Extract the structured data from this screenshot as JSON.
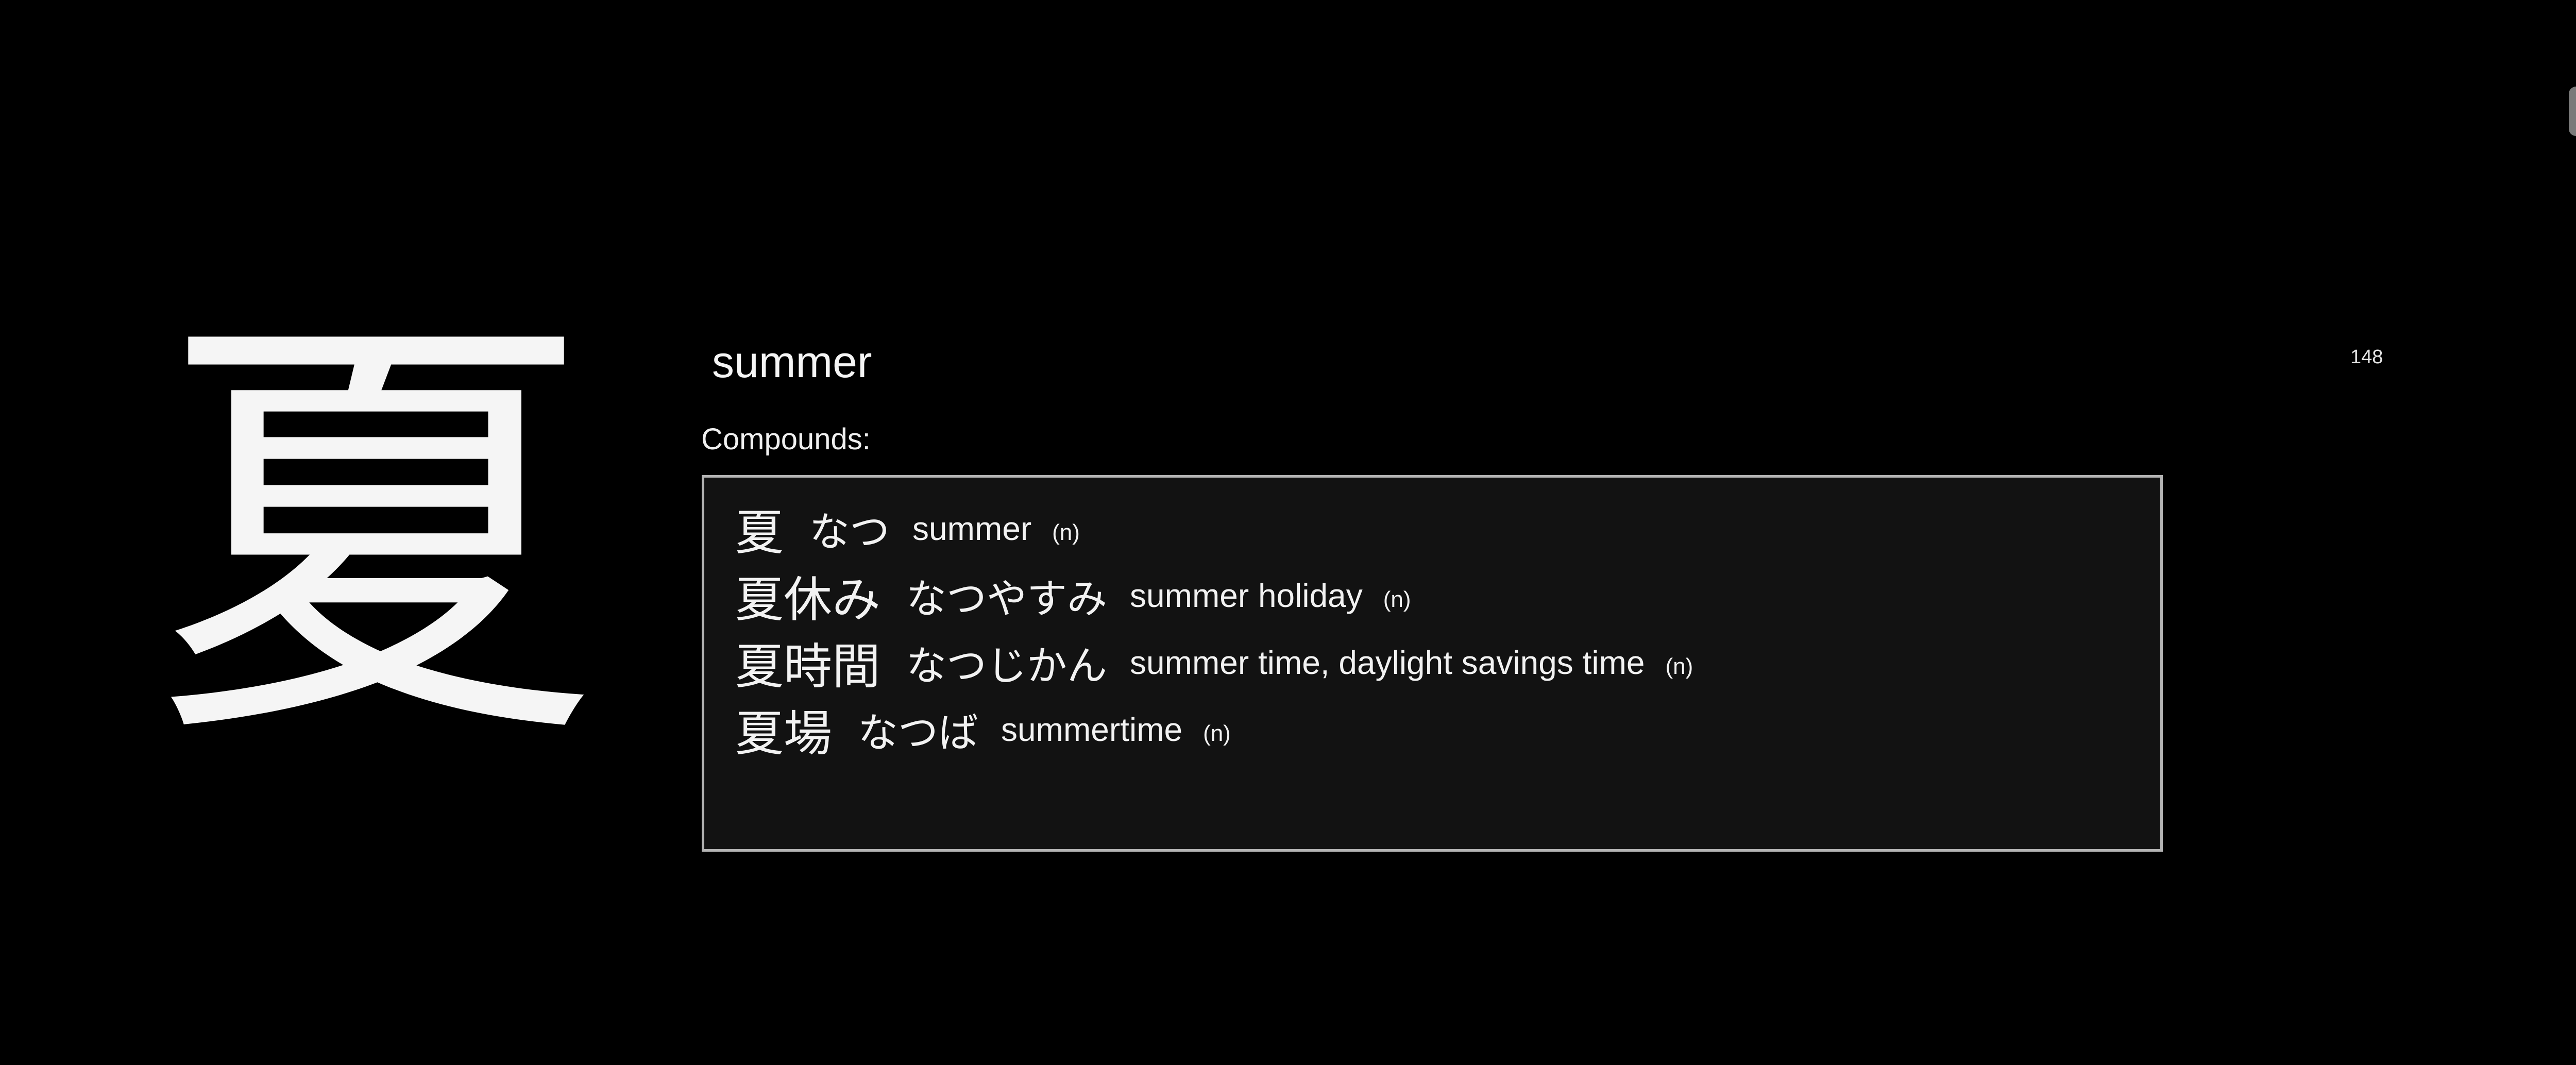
{
  "kanji": "夏",
  "meaning": "summer",
  "counter": "148",
  "compounds_label": "Compounds:",
  "compounds": [
    {
      "word": "夏",
      "reading": "なつ",
      "gloss": "summer",
      "pos": "(n)"
    },
    {
      "word": "夏休み",
      "reading": "なつやすみ",
      "gloss": "summer holiday",
      "pos": "(n)"
    },
    {
      "word": "夏時間",
      "reading": "なつじかん",
      "gloss": "summer time, daylight savings time",
      "pos": "(n)"
    },
    {
      "word": "夏場",
      "reading": "なつば",
      "gloss": "summertime",
      "pos": "(n)"
    }
  ],
  "colors": {
    "background": "#000000",
    "text": "#f2f2f2",
    "box_background": "#121212",
    "box_border": "#b3b3b3"
  }
}
